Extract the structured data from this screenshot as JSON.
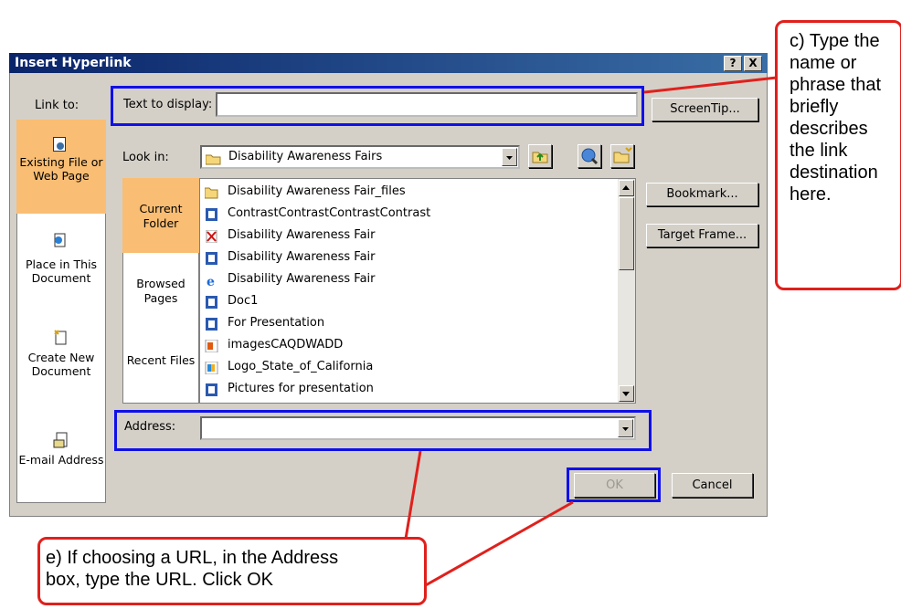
{
  "dialog": {
    "title": "Insert Hyperlink",
    "help_button": "?",
    "close_button": "X",
    "link_to_label": "Link to:",
    "text_to_display_label": "Text to display:",
    "text_to_display_value": "",
    "screentip_button": "ScreenTip...",
    "look_in_label": "Look in:",
    "look_in_value": "Disability Awareness Fairs",
    "bookmark_button": "Bookmark...",
    "target_frame_button": "Target Frame...",
    "address_label": "Address:",
    "address_value": "",
    "ok_button": "OK",
    "cancel_button": "Cancel"
  },
  "link_to": {
    "items": [
      {
        "label": "Existing File or Web Page",
        "icon": "existing-file-icon",
        "selected": true
      },
      {
        "label": "Place in This Document",
        "icon": "place-document-icon",
        "selected": false
      },
      {
        "label": "Create New Document",
        "icon": "new-document-icon",
        "selected": false
      },
      {
        "label": "E-mail Address",
        "icon": "email-icon",
        "selected": false
      }
    ]
  },
  "browse": {
    "items": [
      {
        "label": "Current Folder",
        "selected": true
      },
      {
        "label": "Browsed Pages",
        "selected": false
      },
      {
        "label": "Recent Files",
        "selected": false
      }
    ]
  },
  "files": [
    {
      "name": "Disability Awareness Fair_files",
      "icon": "folder-icon"
    },
    {
      "name": "ContrastContrastContrastContrast",
      "icon": "word-doc-icon"
    },
    {
      "name": "Disability Awareness Fair",
      "icon": "pdf-icon"
    },
    {
      "name": "Disability Awareness Fair",
      "icon": "word-doc-icon"
    },
    {
      "name": "Disability Awareness Fair",
      "icon": "ie-page-icon"
    },
    {
      "name": "Doc1",
      "icon": "word-doc-icon"
    },
    {
      "name": "For Presentation",
      "icon": "word-doc-icon"
    },
    {
      "name": "imagesCAQDWADD",
      "icon": "image-file-icon"
    },
    {
      "name": "Logo_State_of_California",
      "icon": "image-file-icon"
    },
    {
      "name": "Pictures for presentation",
      "icon": "word-doc-icon"
    }
  ],
  "callouts": {
    "text_display_note": "c) Type the name or phrase that briefly describes the link destination here.",
    "text_display_note_lines": [
      "c) Type the",
      "name or",
      "phrase that",
      "briefly",
      "describes",
      "the link",
      "destination",
      "here."
    ],
    "address_note": "e) If choosing a URL, in the Address box, type the URL. Click OK",
    "address_note_lines": [
      "e) If choosing a URL, in the Address",
      "box, type the URL. Click OK"
    ]
  },
  "colors": {
    "title_bar": "#0a246a",
    "dialog_face": "#d4d0c8",
    "selected_item": "#f9bd73",
    "highlight_box": "#1010e8",
    "callout_border": "#e0201c"
  }
}
